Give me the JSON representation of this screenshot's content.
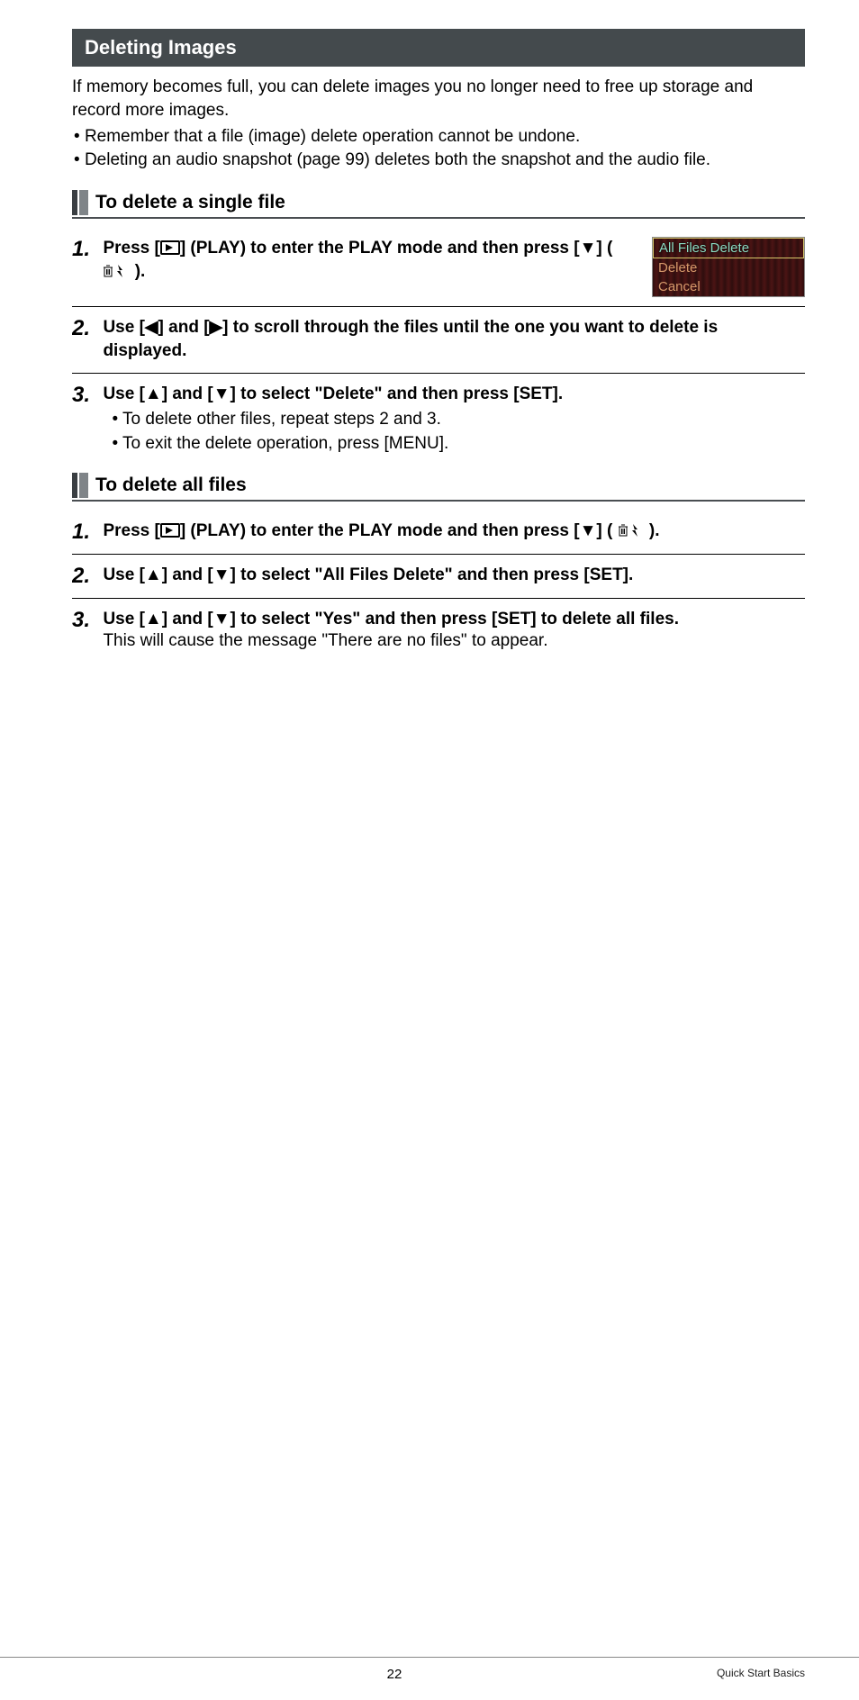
{
  "section_title": "Deleting Images",
  "intro": "If memory becomes full, you can delete images you no longer need to free up storage and record more images.",
  "top_bullets": [
    "Remember that a file (image) delete operation cannot be undone.",
    "Deleting an audio snapshot (page 99) deletes both the snapshot and the audio file."
  ],
  "subhead_single": "To delete a single file",
  "single_steps": {
    "s1_pre": "Press [",
    "s1_mid": "] (PLAY) to enter the PLAY mode and then press [",
    "s1_post": "] ( ",
    "s1_end": " ).",
    "s2_pre": "Use [",
    "s2_mid": "] and [",
    "s2_post": "] to scroll through the files until the one you want to delete is displayed.",
    "s3_pre": "Use [",
    "s3_mid": "] and [",
    "s3_post": "] to select \"Delete\" and then press [SET].",
    "s3_sub": [
      "To delete other files, repeat steps 2 and 3.",
      "To exit the delete operation, press [MENU]."
    ]
  },
  "menu_items": [
    "All Files Delete",
    "Delete",
    "Cancel"
  ],
  "subhead_all": "To delete all files",
  "all_steps": {
    "s1_pre": "Press [",
    "s1_mid": "] (PLAY) to enter the PLAY mode and then press [",
    "s1_post": "] ( ",
    "s1_end": " ).",
    "s2_pre": "Use [",
    "s2_mid": "] and [",
    "s2_post": "] to select \"All Files Delete\" and then press [SET].",
    "s3_pre": "Use [",
    "s3_mid": "] and [",
    "s3_post": "] to select \"Yes\" and then press [SET] to delete all files.",
    "s3_sub": "This will cause the message \"There are no files\" to appear."
  },
  "page_number": "22",
  "footer_crumb": "Quick Start Basics",
  "arrows": {
    "down": "▼",
    "left": "◀",
    "right": "▶",
    "up": "▲"
  }
}
